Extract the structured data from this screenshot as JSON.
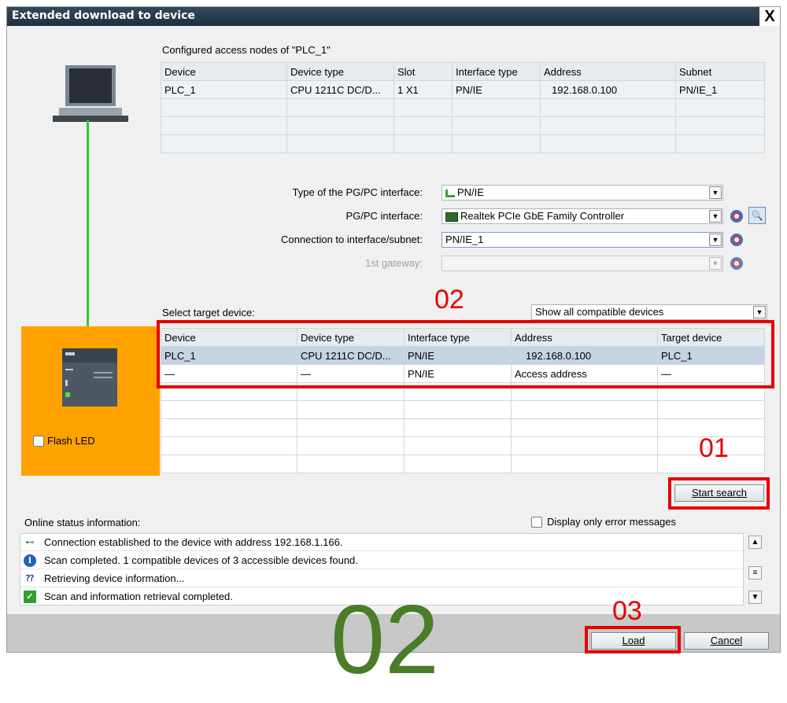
{
  "window": {
    "title": "Extended download to device",
    "close": "X"
  },
  "configured": {
    "heading": "Configured access nodes of \"PLC_1\"",
    "columns": [
      "Device",
      "Device type",
      "Slot",
      "Interface type",
      "Address",
      "Subnet"
    ],
    "rows": [
      [
        "PLC_1",
        "CPU 1211C DC/D...",
        "1 X1",
        "PN/IE",
        "192.168.0.100",
        "PN/IE_1"
      ]
    ]
  },
  "interface": {
    "type_label": "Type of the PG/PC interface:",
    "type_value": "PN/IE",
    "pgpc_label": "PG/PC interface:",
    "pgpc_value": "Realtek PCIe GbE Family Controller",
    "connection_label": "Connection to interface/subnet:",
    "connection_value": "PN/IE_1",
    "gateway_label": "1st gateway:",
    "gateway_value": ""
  },
  "target": {
    "label": "Select target device:",
    "filter_value": "Show all compatible devices",
    "columns": [
      "Device",
      "Device type",
      "Interface type",
      "Address",
      "Target device"
    ],
    "rows": [
      [
        "PLC_1",
        "CPU 1211C DC/D...",
        "PN/IE",
        "192.168.0.100",
        "PLC_1"
      ],
      [
        "—",
        "—",
        "PN/IE",
        "Access address",
        "—"
      ]
    ],
    "flash_led": "Flash LED",
    "start_search": "Start search"
  },
  "status": {
    "label": "Online status information:",
    "only_errors": "Display only error messages",
    "messages": [
      {
        "icon": "connection-icon",
        "text": "Connection established to the device with address 192.168.1.166."
      },
      {
        "icon": "info-icon",
        "text": "Scan completed. 1 compatible devices of 3 accessible devices found."
      },
      {
        "icon": "retrieving-icon",
        "text": "Retrieving device information..."
      },
      {
        "icon": "check-icon",
        "text": "Scan and information retrieval completed."
      }
    ]
  },
  "buttons": {
    "load": "Load",
    "cancel": "Cancel"
  },
  "annotations": {
    "a01": "01",
    "a02": "02",
    "a03": "03",
    "big02": "02"
  },
  "colors": {
    "accent_red": "#e60000",
    "annotation_green": "#4a7c2a",
    "orange_panel": "#ffa200",
    "link_green": "#33cc33"
  }
}
